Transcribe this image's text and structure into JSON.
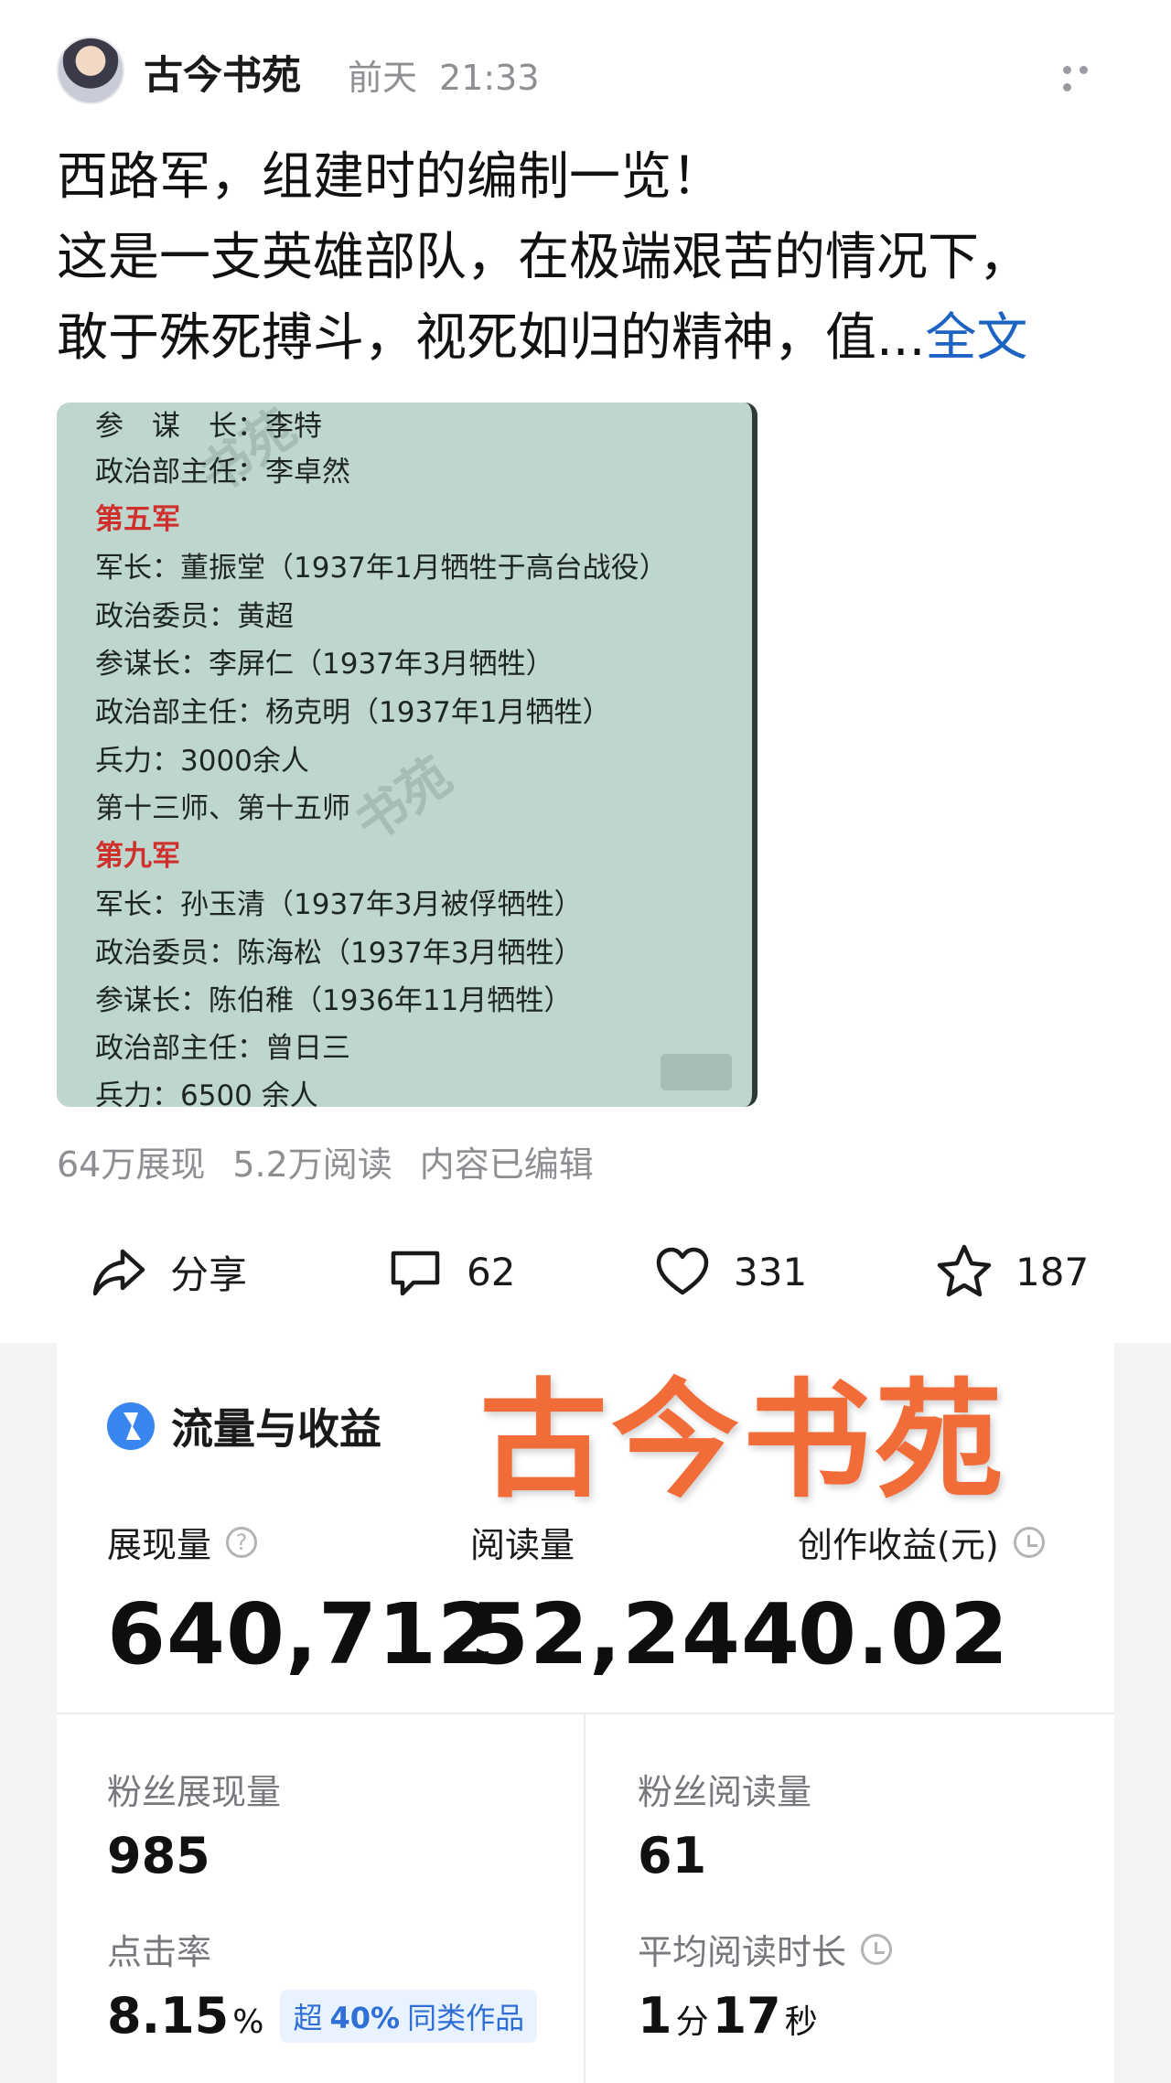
{
  "post": {
    "author": "古今书苑",
    "time_rel": "前天",
    "time_clock": "21:33",
    "lines": [
      "西路军，组建时的编制一览！",
      "这是一支英雄部队，在极端艰苦的情况下，",
      "敢于殊死搏斗，视死如归的精神，值..."
    ],
    "full_link": "全文"
  },
  "image_doc": {
    "lines": [
      {
        "text": "参　谋　长：李特",
        "red": false
      },
      {
        "text": "政治部主任：李卓然",
        "red": false
      },
      {
        "text": "第五军",
        "red": true
      },
      {
        "text": "军长：董振堂（1937年1月牺牲于高台战役）",
        "red": false
      },
      {
        "text": "政治委员：黄超",
        "red": false
      },
      {
        "text": "参谋长：李屏仁（1937年3月牺牲）",
        "red": false
      },
      {
        "text": "政治部主任：杨克明（1937年1月牺牲）",
        "red": false
      },
      {
        "text": "兵力：3000余人",
        "red": false
      },
      {
        "text": "第十三师、第十五师",
        "red": false
      },
      {
        "text": "第九军",
        "red": true
      },
      {
        "text": "军长：孙玉清（1937年3月被俘牺牲）",
        "red": false
      },
      {
        "text": "政治委员：陈海松（1937年3月牺牲）",
        "red": false
      },
      {
        "text": "参谋长：陈伯稚（1936年11月牺牲）",
        "red": false
      },
      {
        "text": "政治部主任：曾日三",
        "red": false
      },
      {
        "text": "兵力：6500 余人",
        "red": false
      }
    ],
    "watermark": "书苑"
  },
  "stats": {
    "impressions": "64万展现",
    "reads": "5.2万阅读",
    "edited": "内容已编辑"
  },
  "actions": {
    "share_label": "分享",
    "comments": "62",
    "likes": "331",
    "favorites": "187"
  },
  "analytics": {
    "title": "流量与收益",
    "brand_watermark": "古今书苑",
    "metrics": [
      {
        "label": "展现量",
        "value": "640,712"
      },
      {
        "label": "阅读量",
        "value": "52,244"
      },
      {
        "label": "创作收益(元)",
        "value": "0.02"
      }
    ],
    "fan_impressions_label": "粉丝展现量",
    "fan_impressions_value": "985",
    "fan_reads_label": "粉丝阅读量",
    "fan_reads_value": "61",
    "ctr_label": "点击率",
    "ctr_value": "8.15",
    "ctr_unit": "%",
    "ctr_badge_prefix": "超",
    "ctr_badge_pct": "40%",
    "ctr_badge_suffix": "同类作品",
    "avg_read_label": "平均阅读时长",
    "avg_read_min": "1",
    "avg_read_min_unit": "分",
    "avg_read_sec": "17",
    "avg_read_sec_unit": "秒"
  }
}
